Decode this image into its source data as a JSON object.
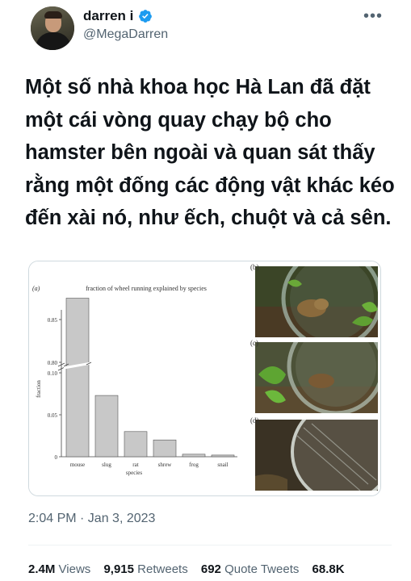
{
  "author": {
    "name": "darren i",
    "handle": "@MegaDarren"
  },
  "tweet": {
    "text": "Một số nhà khoa học Hà Lan đã đặt một cái vòng quay chạy bộ cho hamster bên ngoài và quan sát thấy rằng một đống các động vật khác kéo đến xài nó, như ếch, chuột và cả sên.",
    "timestamp": "2:04 PM · Jan 3, 2023"
  },
  "stats": {
    "views_count": "2.4M",
    "views_label": "Views",
    "retweets_count": "9,915",
    "retweets_label": "Retweets",
    "quotes_count": "692",
    "quotes_label": "Quote Tweets",
    "likes_count": "68.8K"
  },
  "icons": {
    "verified": "verified-badge-icon",
    "more": "more-options-icon"
  },
  "colors": {
    "verified_blue": "#1d9bf0",
    "bar_fill": "#c8c8c8",
    "secondary_text": "#536471"
  },
  "figure": {
    "panel_labels": {
      "a": "(a)",
      "b": "(b)",
      "c": "(c)",
      "d": "(d)"
    }
  },
  "chart_data": {
    "type": "bar",
    "title": "fraction of wheel running explained by species",
    "xlabel": "species",
    "ylabel": "fraction",
    "categories": [
      "mouse",
      "slug",
      "rat",
      "shrew",
      "frog",
      "snail"
    ],
    "values": [
      0.875,
      0.073,
      0.03,
      0.02,
      0.003,
      0.002
    ],
    "broken_y_axis": true,
    "y_ticks_lower": [
      "0",
      "0.05",
      "0.10"
    ],
    "y_ticks_upper": [
      "0.80",
      "0.85"
    ],
    "grid": false,
    "legend": "none"
  }
}
